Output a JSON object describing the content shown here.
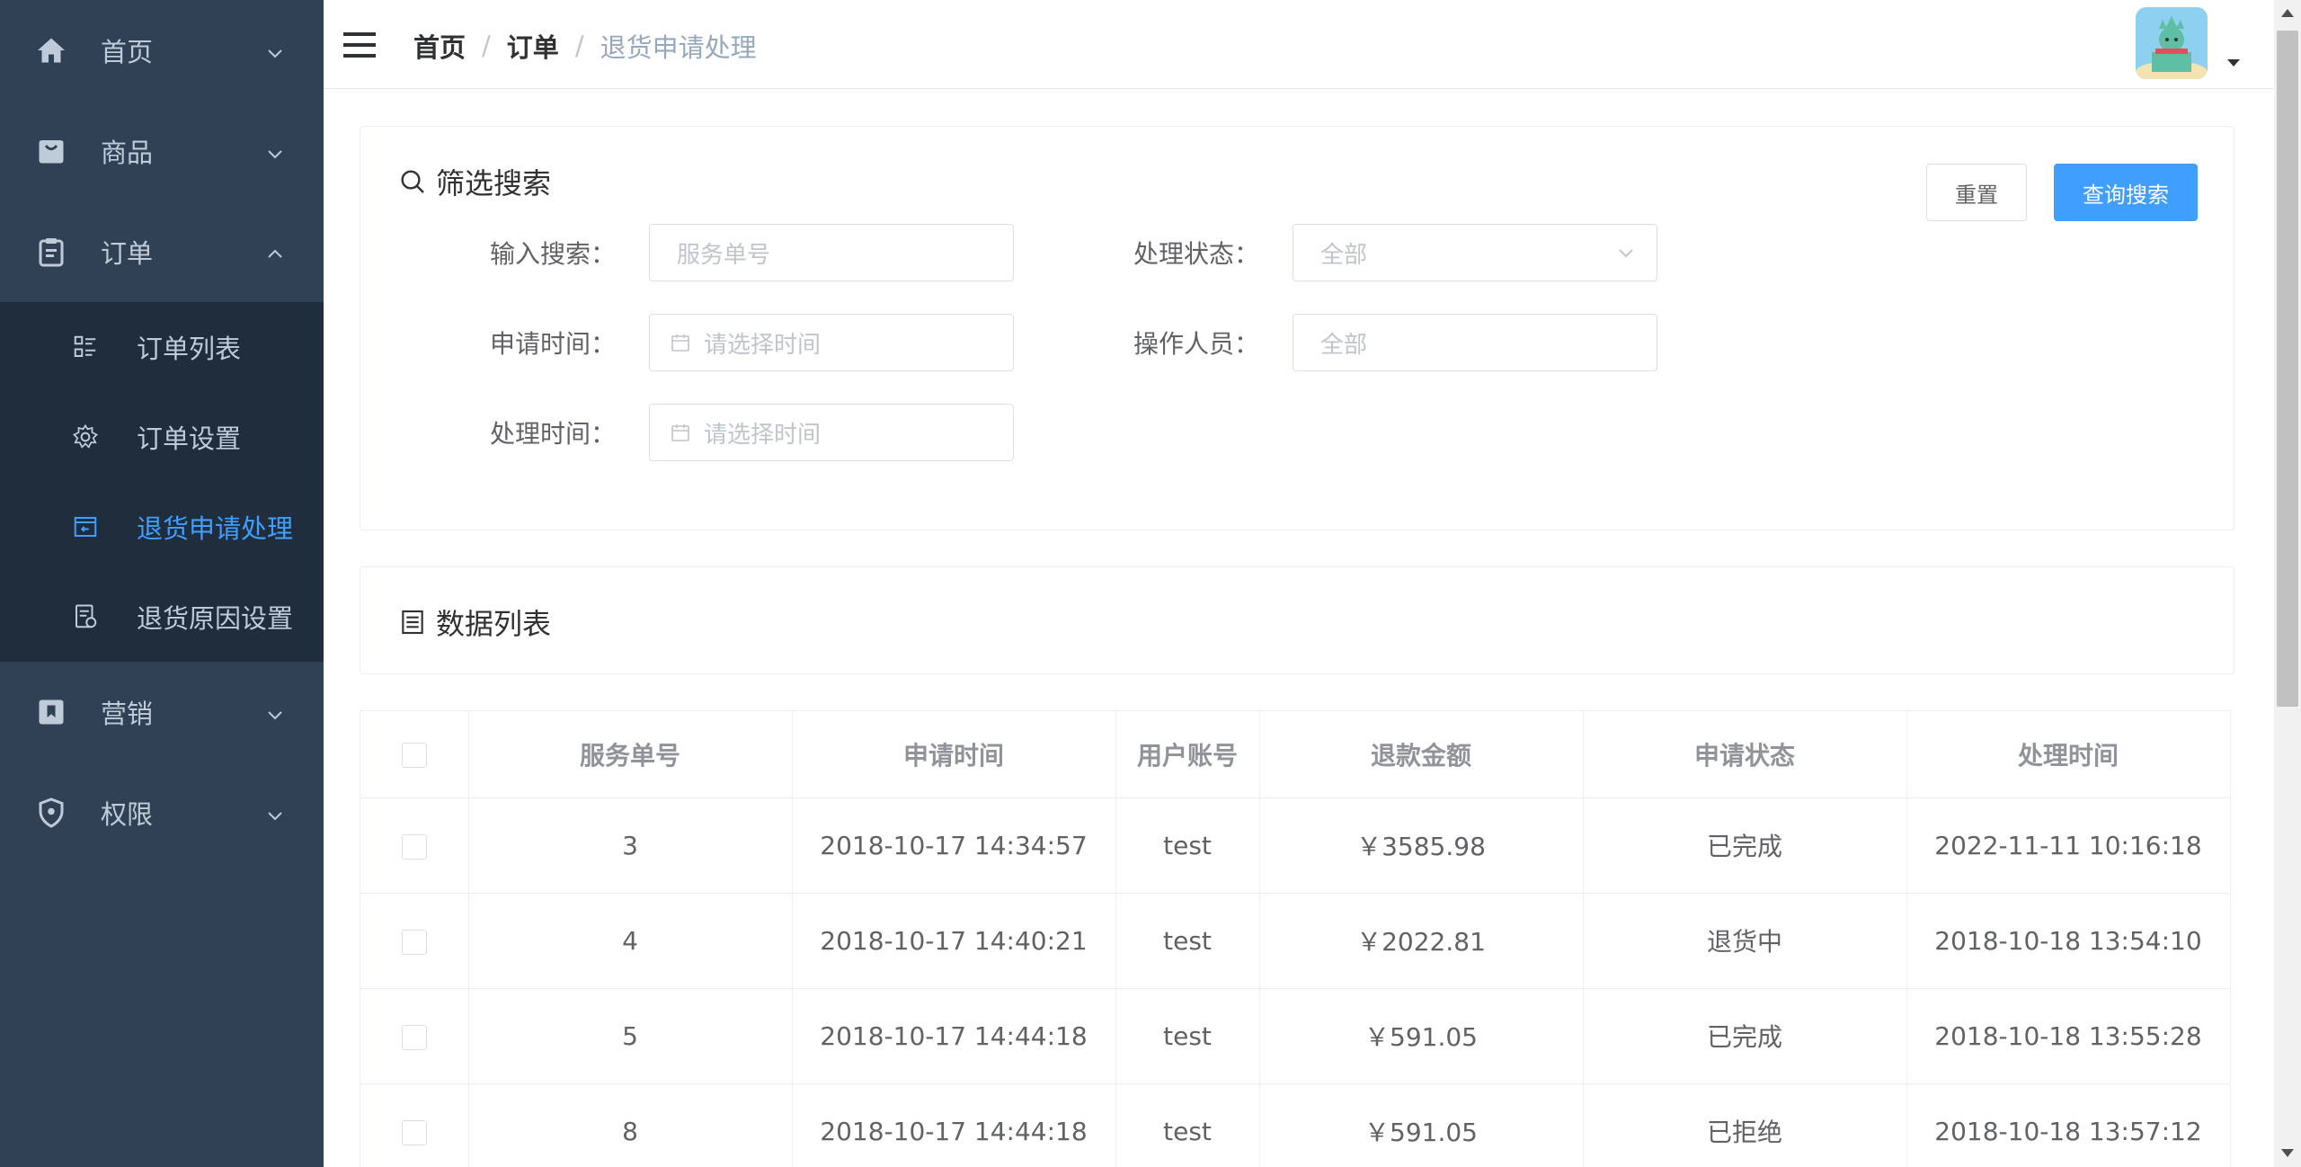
{
  "sidebar": {
    "menus": [
      {
        "label": "首页",
        "icon": "home-icon"
      },
      {
        "label": "商品",
        "icon": "shopping-bag-icon"
      },
      {
        "label": "订单",
        "icon": "clipboard-icon"
      },
      {
        "label": "营销",
        "icon": "bookmark-icon"
      },
      {
        "label": "权限",
        "icon": "shield-icon"
      }
    ],
    "submenu": [
      {
        "label": "订单列表",
        "icon": "list-icon"
      },
      {
        "label": "订单设置",
        "icon": "gear-icon"
      },
      {
        "label": "退货申请处理",
        "icon": "return-box-icon",
        "active": true
      },
      {
        "label": "退货原因设置",
        "icon": "document-icon"
      }
    ],
    "colors": {
      "bg": "#304156",
      "sub_bg": "#1f2d3d",
      "text": "#bfcbd9",
      "active": "#409eff"
    }
  },
  "navbar": {
    "breadcrumb": [
      "首页",
      "订单",
      "退货申请处理"
    ],
    "separator": "/"
  },
  "filter": {
    "title": "筛选搜索",
    "reset_label": "重置",
    "search_label": "查询搜索",
    "fields": {
      "keyword": {
        "label": "输入搜索：",
        "placeholder": "服务单号"
      },
      "status": {
        "label": "处理状态：",
        "value": "全部"
      },
      "apply_time": {
        "label": "申请时间：",
        "placeholder": "请选择时间"
      },
      "operator": {
        "label": "操作人员：",
        "placeholder": "全部"
      },
      "handle_time": {
        "label": "处理时间：",
        "placeholder": "请选择时间"
      }
    }
  },
  "list": {
    "title": "数据列表",
    "columns": [
      "服务单号",
      "申请时间",
      "用户账号",
      "退款金额",
      "申请状态",
      "处理时间"
    ],
    "rows": [
      {
        "id": "3",
        "apply_time": "2018-10-17 14:34:57",
        "user": "test",
        "amount": "￥3585.98",
        "status": "已完成",
        "handle_time": "2022-11-11 10:16:18"
      },
      {
        "id": "4",
        "apply_time": "2018-10-17 14:40:21",
        "user": "test",
        "amount": "￥2022.81",
        "status": "退货中",
        "handle_time": "2018-10-18 13:54:10"
      },
      {
        "id": "5",
        "apply_time": "2018-10-17 14:44:18",
        "user": "test",
        "amount": "￥591.05",
        "status": "已完成",
        "handle_time": "2018-10-18 13:55:28"
      },
      {
        "id": "8",
        "apply_time": "2018-10-17 14:44:18",
        "user": "test",
        "amount": "￥591.05",
        "status": "已拒绝",
        "handle_time": "2018-10-18 13:57:12"
      }
    ]
  },
  "colors": {
    "primary": "#409eff",
    "border": "#dcdfe6"
  }
}
